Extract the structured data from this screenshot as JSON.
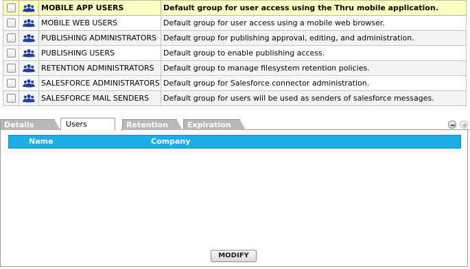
{
  "groups": [
    {
      "name": "MOBILE APP USERS",
      "description": "Default group for user access using the Thru mobile application.",
      "selected": true
    },
    {
      "name": "MOBILE WEB USERS",
      "description": "Default group for user access using a mobile web browser.",
      "selected": false
    },
    {
      "name": "PUBLISHING ADMINISTRATORS",
      "description": "Default group for publishing approval, editing, and administration.",
      "selected": false
    },
    {
      "name": "PUBLISHING USERS",
      "description": "Default group to enable publishing access.",
      "selected": false
    },
    {
      "name": "RETENTION ADMINISTRATORS",
      "description": "Default group to manage filesystem retention policies.",
      "selected": false
    },
    {
      "name": "SALESFORCE ADMINISTRATORS",
      "description": "Default group for Salesforce connector administration.",
      "selected": false
    },
    {
      "name": "SALESFORCE MAIL SENDERS",
      "description": "Default group for users will be used as senders of salesforce messages.",
      "selected": false
    }
  ],
  "group_icon": "users-group-icon",
  "tabs": [
    {
      "label": "Details",
      "active": false
    },
    {
      "label": "Users",
      "active": true
    },
    {
      "label": "Retention",
      "active": false
    },
    {
      "label": "Expiration",
      "active": false
    }
  ],
  "panel_controls": {
    "collapse_icon": "collapse-circle-icon",
    "expand_icon": "expand-circle-icon"
  },
  "users_table": {
    "columns": {
      "name": "Name",
      "company": "Company"
    },
    "rows": []
  },
  "modify_button": {
    "label": "MODIFY"
  },
  "colors": {
    "selected_row": "#ffffc2",
    "header_blue": "#1aaee8",
    "icon_blue": "#1f3fa0",
    "tab_inactive": "#b8b8b8"
  }
}
